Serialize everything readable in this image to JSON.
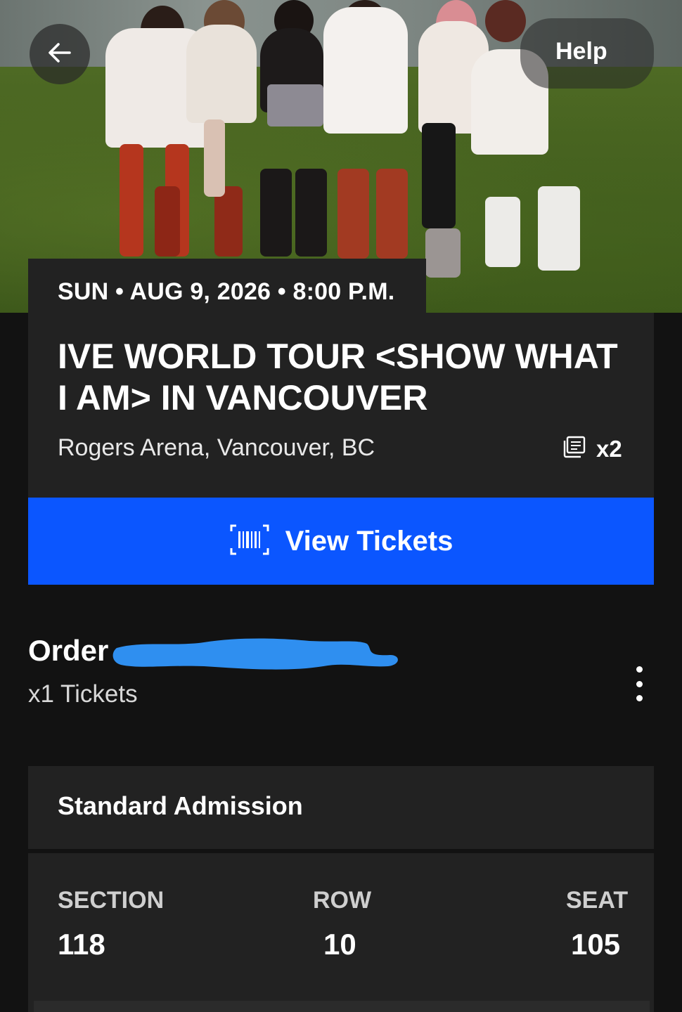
{
  "header": {
    "help_label": "Help"
  },
  "event": {
    "date_line": "SUN • AUG 9, 2026 • 8:00 P.M.",
    "title": "IVE WORLD TOUR <SHOW WHAT I AM> IN VANCOUVER",
    "venue": "Rogers Arena, Vancouver, BC",
    "ticket_count": "x2"
  },
  "actions": {
    "view_tickets_label": "View Tickets"
  },
  "order": {
    "label": "Order",
    "tickets_line": "x1 Tickets"
  },
  "admission": {
    "label": "Standard Admission"
  },
  "seat": {
    "section_label": "SECTION",
    "section_value": "118",
    "row_label": "ROW",
    "row_value": "10",
    "seat_label": "SEAT",
    "seat_value": "105"
  },
  "colors": {
    "background": "#121212",
    "card": "#222222",
    "accent_blue": "#0b56ff",
    "redaction_blue": "#2f8ff0"
  },
  "icons": {
    "back": "arrow-left-icon",
    "ticket_stack": "ticket-stack-icon",
    "barcode": "barcode-icon",
    "more": "more-vertical-icon"
  }
}
